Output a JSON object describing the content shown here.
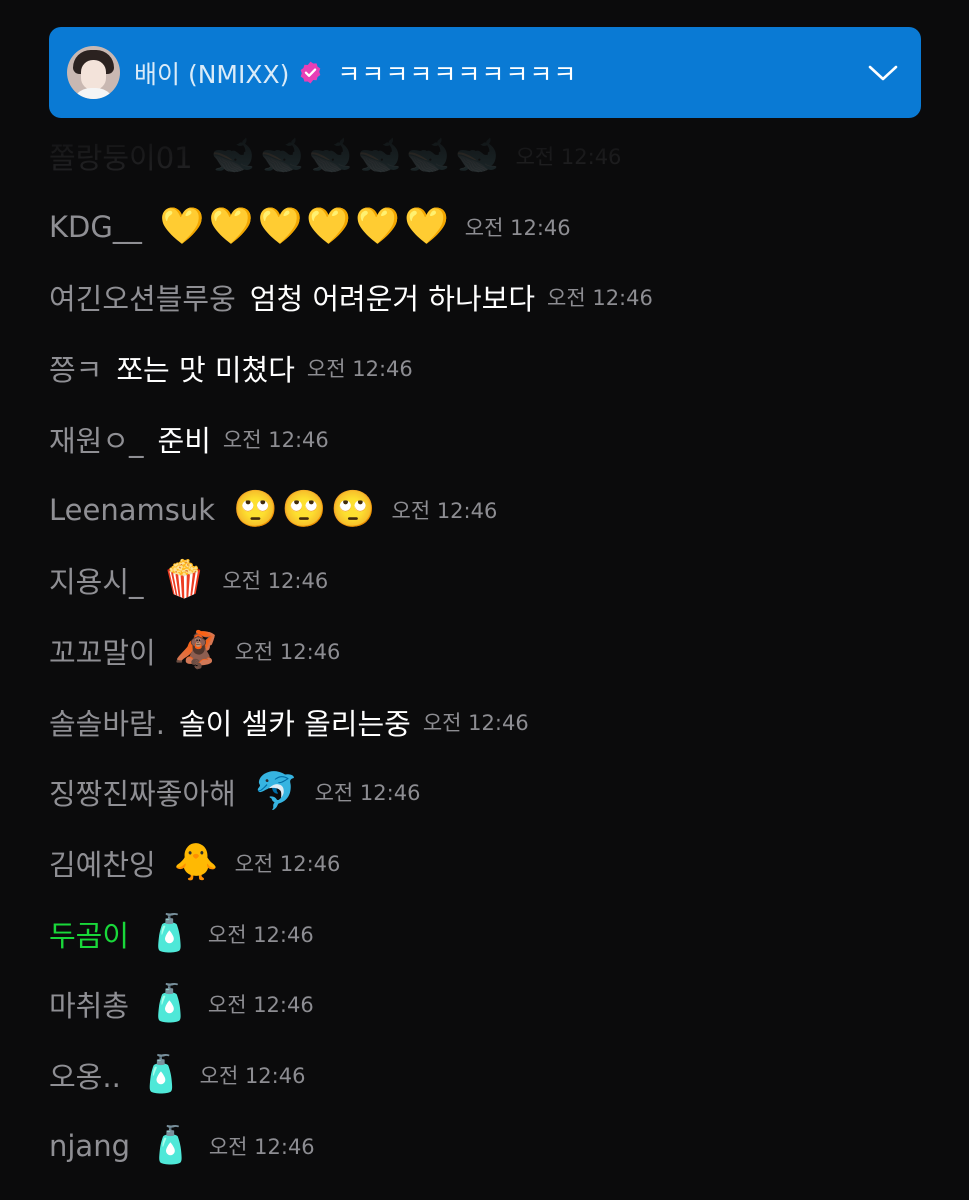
{
  "pinned": {
    "name": "배이 (NMIXX)",
    "message": "ㅋㅋㅋㅋㅋㅋㅋㅋㅋㅋ",
    "avatar_icon": "profile-photo",
    "verified_icon": "verified-badge-icon",
    "expand_icon": "chevron-down-icon",
    "colors": {
      "banner": "#0a7ad4",
      "verified": "#e83fb6"
    }
  },
  "messages": [
    {
      "user": "쫄랑둥이01",
      "text": "",
      "emoji": "🐋🐋🐋🐋🐋🐋",
      "time": "오전 12:46"
    },
    {
      "user": "KDG__",
      "text": "",
      "emoji": "💛💛💛💛💛💛",
      "time": "오전 12:46"
    },
    {
      "user": "여긴오션블루웅",
      "text": "엄청 어려운거 하나보다",
      "emoji": "",
      "time": "오전 12:46"
    },
    {
      "user": "쯩ㅋ",
      "text": "쪼는 맛 미쳤다",
      "emoji": "",
      "time": "오전 12:46"
    },
    {
      "user": "재원ㅇ_",
      "text": "준비",
      "emoji": "",
      "time": "오전 12:46"
    },
    {
      "user": "Leenamsuk",
      "text": "",
      "emoji": "🙄🙄🙄",
      "time": "오전 12:46"
    },
    {
      "user": "지용시_",
      "text": "",
      "emoji": "🍿",
      "time": "오전 12:46"
    },
    {
      "user": "꼬꼬말이",
      "text": "",
      "emoji": "🦧",
      "time": "오전 12:46"
    },
    {
      "user": "솔솔바람.",
      "text": "솔이 셀카 올리는중",
      "emoji": "",
      "time": "오전 12:46"
    },
    {
      "user": "징짱진짜좋아해",
      "text": "",
      "emoji": "🐬",
      "time": "오전 12:46"
    },
    {
      "user": "김예찬잉",
      "text": "",
      "emoji": "🐥",
      "time": "오전 12:46"
    },
    {
      "user": "두곰이",
      "text": "",
      "emoji": "🧴",
      "time": "오전 12:46",
      "user_color": "#19d83a"
    },
    {
      "user": "마취총",
      "text": "",
      "emoji": "🧴",
      "time": "오전 12:46"
    },
    {
      "user": "오옹..",
      "text": "",
      "emoji": "🧴",
      "time": "오전 12:46"
    },
    {
      "user": "njang",
      "text": "",
      "emoji": "🧴",
      "time": "오전 12:46"
    }
  ]
}
